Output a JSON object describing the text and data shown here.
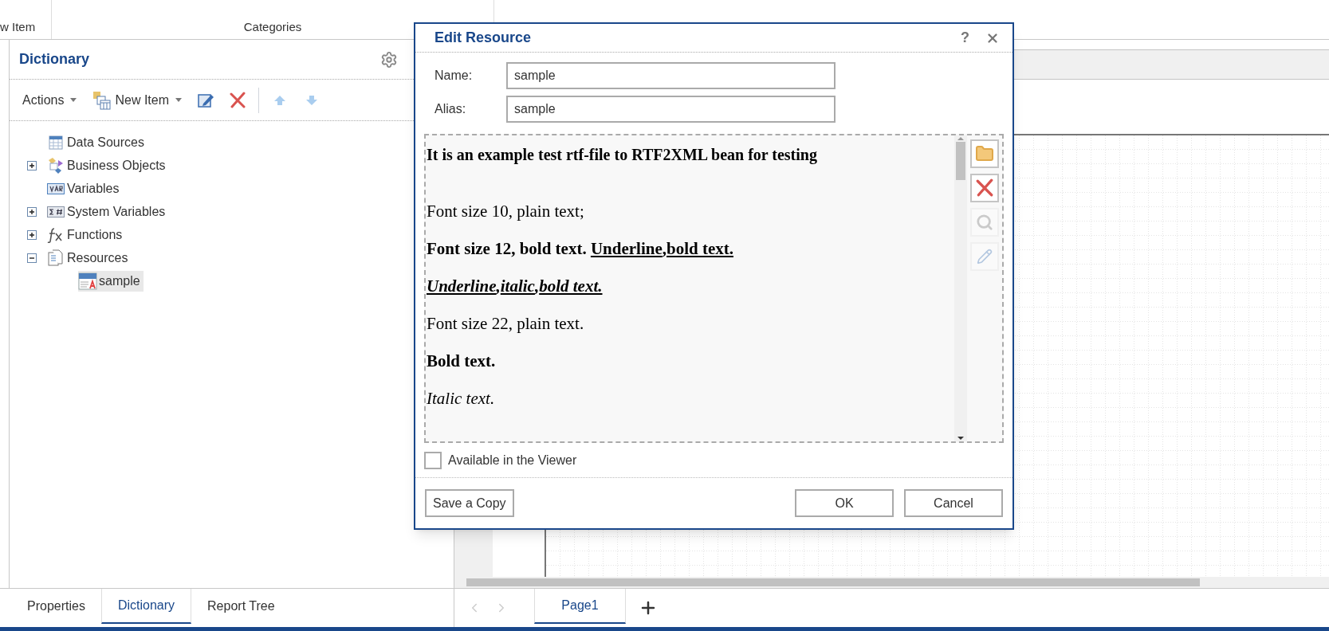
{
  "top_strip": {
    "cells": [
      "w Item",
      "Categories"
    ]
  },
  "dictionary": {
    "title": "Dictionary",
    "toolbar": [
      {
        "kind": "menu",
        "label": "Actions",
        "disabled": false
      },
      {
        "kind": "menu",
        "label": "New Item",
        "disabled": false
      },
      {
        "kind": "edit",
        "disabled": false
      },
      {
        "kind": "delete",
        "disabled": false
      },
      {
        "kind": "separator"
      },
      {
        "kind": "up",
        "disabled": true
      },
      {
        "kind": "down",
        "disabled": true
      }
    ],
    "tree": [
      {
        "label": "Data Sources",
        "kind": "datasource"
      },
      {
        "label": "Business Objects",
        "kind": "business",
        "expanded": false
      },
      {
        "label": "Variables",
        "kind": "variable"
      },
      {
        "label": "System Variables",
        "kind": "sysvar",
        "expanded": false
      },
      {
        "label": "Functions",
        "kind": "function",
        "expanded": false
      },
      {
        "label": "Resources",
        "kind": "resources",
        "expanded": true,
        "children": [
          {
            "label": "sample",
            "kind": "rtf",
            "selected": true
          }
        ]
      }
    ]
  },
  "panel_tabs": [
    {
      "label": "Properties",
      "selected": false
    },
    {
      "label": "Dictionary",
      "selected": true
    },
    {
      "label": "Report Tree",
      "selected": false
    }
  ],
  "page_tabs": [
    {
      "label": "Page1",
      "selected": true
    }
  ],
  "dialog": {
    "title": "Edit Resource",
    "help": "?",
    "fields": [
      {
        "label": "Name:",
        "value": "sample"
      },
      {
        "label": "Alias:",
        "value": "sample"
      }
    ],
    "content": [
      {
        "kind": "heading",
        "runs": [
          {
            "text": "It is an example test rtf-file to RTF2XML bean for testing",
            "underline": false
          }
        ]
      },
      {
        "kind": "plain",
        "runs": [
          {
            "text": "Font size 10, plain text;",
            "underline": false
          }
        ]
      },
      {
        "kind": "bold",
        "runs": [
          {
            "text": "Font size 12, bold text. ",
            "underline": false
          },
          {
            "text": "Underline",
            "underline": true
          },
          {
            "text": ",",
            "underline": false
          },
          {
            "text": "bold text.",
            "underline": true
          }
        ]
      },
      {
        "kind": "bold-italic",
        "runs": [
          {
            "text": "Underline",
            "underline": true
          },
          {
            "text": ",",
            "underline": false
          },
          {
            "text": "italic",
            "underline": true
          },
          {
            "text": ",",
            "underline": false
          },
          {
            "text": "bold text.",
            "underline": true
          }
        ]
      },
      {
        "kind": "plain",
        "runs": [
          {
            "text": "Font size 22, plain text.",
            "underline": false
          }
        ]
      },
      {
        "kind": "bold",
        "runs": [
          {
            "text": "Bold text.",
            "underline": false
          }
        ]
      },
      {
        "kind": "italic",
        "runs": [
          {
            "text": "Italic text.",
            "underline": false
          }
        ]
      }
    ],
    "side_buttons": [
      {
        "kind": "open",
        "disabled": false
      },
      {
        "kind": "delete",
        "disabled": false
      },
      {
        "kind": "view",
        "disabled": true
      },
      {
        "kind": "edit",
        "disabled": true
      }
    ],
    "checkbox": {
      "label": "Available in the Viewer",
      "checked": false
    },
    "buttons": [
      {
        "label": "Save a Copy"
      },
      {
        "label": "OK"
      },
      {
        "label": "Cancel"
      }
    ]
  }
}
